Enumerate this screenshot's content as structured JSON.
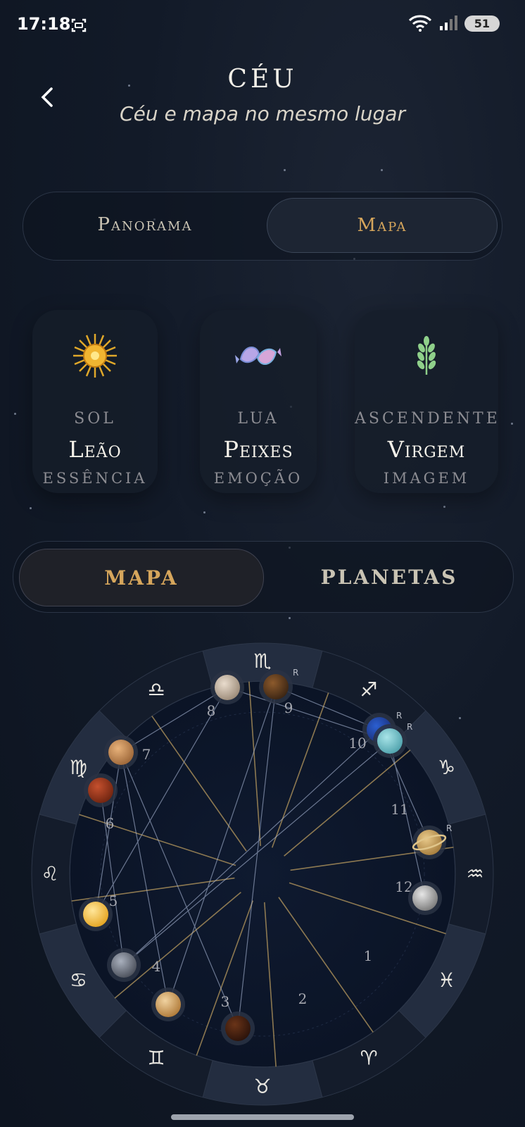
{
  "status_bar": {
    "time": "17:18",
    "battery": "51"
  },
  "header": {
    "title": "CÉU",
    "subtitle": "Céu e mapa no mesmo lugar"
  },
  "view_toggle": {
    "options": [
      "Panorama",
      "Mapa"
    ],
    "selected": "Mapa"
  },
  "big_three": [
    {
      "key": "SOL",
      "sign": "Leão",
      "meaning": "ESSÊNCIA",
      "icon": "sun-icon"
    },
    {
      "key": "LUA",
      "sign": "Peixes",
      "meaning": "EMOÇÃO",
      "icon": "pisces-fish-icon"
    },
    {
      "key": "ASCENDENTE",
      "sign": "Virgem",
      "meaning": "IMAGEM",
      "icon": "wheat-icon"
    }
  ],
  "content_tabs": {
    "options": [
      "MAPA",
      "PLANETAS"
    ],
    "selected": "MAPA"
  },
  "chart_wheel": {
    "signs": [
      "♏",
      "♐",
      "♑",
      "♒",
      "♓",
      "♈",
      "♉",
      "♊",
      "♋",
      "♌",
      "♍",
      "♎"
    ],
    "houses": [
      "1",
      "2",
      "3",
      "4",
      "5",
      "6",
      "7",
      "8",
      "9",
      "10",
      "11",
      "12"
    ],
    "retrograde_mark": "R"
  },
  "colors": {
    "accent": "#d6a65c",
    "background": "#121a28",
    "line_gold": "#b89a5e",
    "line_blue": "#aab8d6"
  }
}
